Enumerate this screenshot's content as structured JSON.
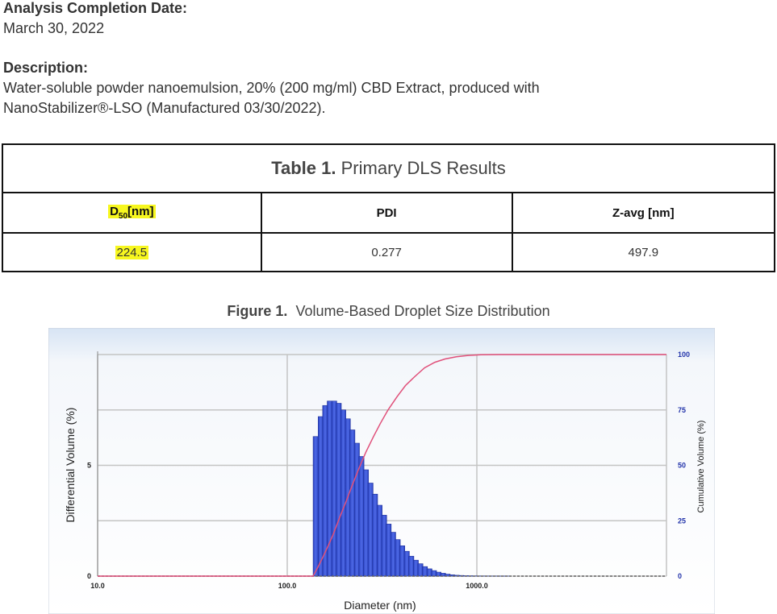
{
  "header": {
    "completion_label": "Analysis Completion  Date:",
    "completion_value": "March 30, 2022",
    "description_label": "Description:",
    "description_line1": "Water-soluble powder nanoemulsion, 20% (200 mg/ml) CBD Extract, produced with",
    "description_line2": "NanoStabilizer®-LSO (Manufactured 03/30/2022)."
  },
  "table": {
    "caption_bold": "Table 1.",
    "caption_text": "Primary DLS Results",
    "col1_main": "D",
    "col1_sub": "50",
    "col1_unit": "[nm]",
    "col2": "PDI",
    "col3": "Z-avg [nm]",
    "row": [
      "224.5",
      "0.277",
      "497.9"
    ],
    "highlight_color": "#f7f71f"
  },
  "figure": {
    "title_bold": "Figure 1.",
    "title_text": "Volume-Based Droplet Size Distribution"
  },
  "chart_data": {
    "type": "bar",
    "xlabel": "Diameter (nm)",
    "ylabel": "Differential Volume (%)",
    "y2label": "Cumulative Volume (%)",
    "xscale": "log",
    "xlim": [
      10,
      10000
    ],
    "ylim": [
      0,
      10
    ],
    "y2lim": [
      0,
      100
    ],
    "xticks": [
      "10.0",
      "100.0",
      "1000.0"
    ],
    "yticks": [
      "0",
      "5"
    ],
    "y2ticks": [
      "0",
      "25",
      "50",
      "75",
      "100"
    ],
    "grid": true,
    "bar_color": "#3a55d4",
    "line_color": "#e0507a",
    "series": [
      {
        "kind": "bars",
        "x": [
          141.2,
          150.1,
          158.5,
          167.5,
          177.0,
          187.0,
          197.6,
          208.8,
          220.6,
          233.1,
          246.3,
          260.2,
          275.0,
          290.5,
          307.0,
          324.4,
          342.7,
          362.1,
          382.6,
          404.3,
          427.2,
          451.3,
          476.9,
          503.9,
          532.4,
          562.5,
          594.4,
          628.0,
          663.6,
          701.2,
          740.9,
          782.8,
          827.2,
          874.0,
          923.5,
          975.8,
          1031.0,
          1089.5,
          1151.2,
          1216.3,
          1285.2,
          1357.9,
          1434.8,
          1516.0
        ],
        "values": [
          6.3,
          7.2,
          7.7,
          7.9,
          7.9,
          7.8,
          7.5,
          7.1,
          6.6,
          6.0,
          5.4,
          4.8,
          4.2,
          3.7,
          3.2,
          2.75,
          2.35,
          1.98,
          1.65,
          1.37,
          1.12,
          0.9,
          0.72,
          0.56,
          0.43,
          0.33,
          0.25,
          0.18,
          0.13,
          0.09,
          0.06,
          0.04,
          0.03,
          0.02,
          0.015,
          0.01,
          0.008,
          0.006,
          0.004,
          0.003,
          0.002,
          0.001,
          0.001,
          0.0
        ]
      },
      {
        "kind": "line",
        "x": [
          10,
          100,
          137,
          145,
          155,
          165,
          175,
          190,
          205,
          220,
          240,
          260,
          285,
          310,
          340,
          380,
          420,
          470,
          530,
          600,
          680,
          780,
          900,
          1050,
          1300,
          2000,
          10000
        ],
        "values": [
          0,
          0,
          0,
          4,
          9,
          14,
          19,
          27,
          34,
          41,
          49,
          56,
          63,
          69,
          75,
          81,
          86,
          90,
          94,
          96.5,
          98,
          99,
          99.6,
          99.9,
          100,
          100,
          100
        ]
      }
    ]
  }
}
